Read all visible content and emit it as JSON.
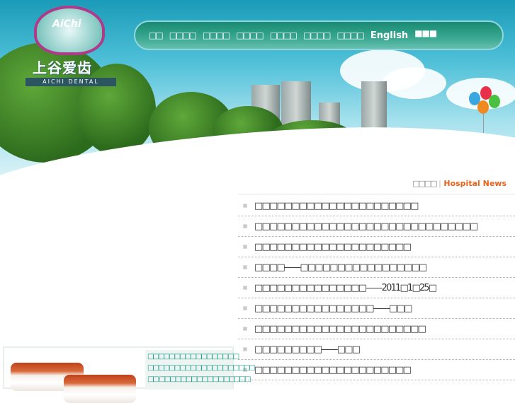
{
  "logo": {
    "brand_en": "AiChi",
    "brand_cn": "上谷爱齿",
    "tagline": "AICHI DENTAL"
  },
  "nav": {
    "items": [
      "□□",
      "□□□□",
      "□□□□",
      "□□□□",
      "□□□□",
      "□□□□",
      "□□□□"
    ],
    "english": "English",
    "extra": "■■■"
  },
  "news": {
    "title_cn": "□□□□",
    "separator": "|",
    "title_en": "Hospital News",
    "items": [
      "□□□□□□□□□□□□□□□□□□□□□□",
      "□□□□□□□□□□□□□□□□□□□□□□□□□□□□□□",
      "□□□□□□□□□□□□□□□□□□□□□",
      "□□□□——□□□□□□□□□□□□□□□□□",
      "□□□□□□□□□□□□□□□——2011□1□25□",
      "□□□□□□□□□□□□□□□□——□□□",
      "□□□□□□□□□□□□□□□□□□□□□□□",
      "□□□□□□□□□——□□□",
      "□□□□□□□□□□□□□□□□□□□□□"
    ]
  },
  "promo": {
    "lines": [
      "□□□□□□□□□□□□□□□□□",
      "□□□□□□□□□□□□□□□□□□□□",
      "□□ □□□□□□□□□□□□□□□□□"
    ]
  }
}
